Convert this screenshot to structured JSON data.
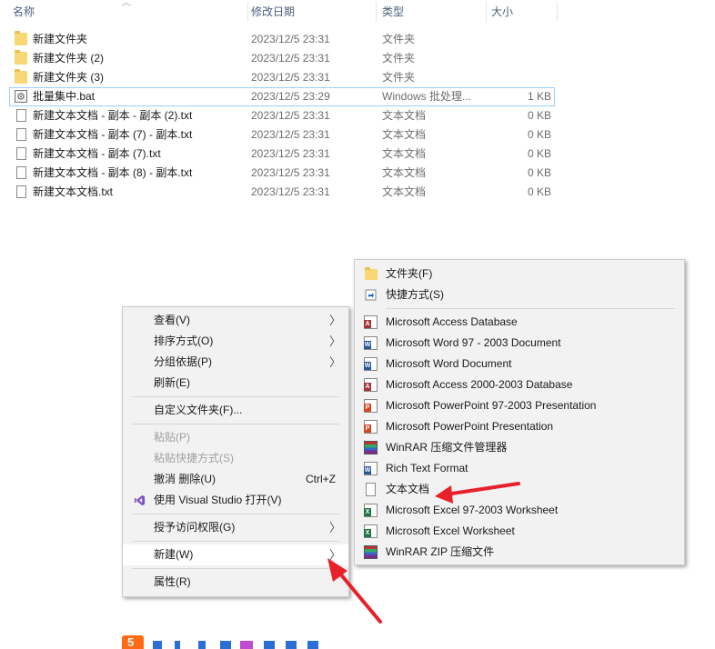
{
  "columns": {
    "name": "名称",
    "date": "修改日期",
    "type": "类型",
    "size": "大小"
  },
  "files": [
    {
      "name": "新建文件夹",
      "date": "2023/12/5 23:31",
      "type": "文件夹",
      "size": "",
      "icon": "folder-icon"
    },
    {
      "name": "新建文件夹 (2)",
      "date": "2023/12/5 23:31",
      "type": "文件夹",
      "size": "",
      "icon": "folder-icon"
    },
    {
      "name": "新建文件夹 (3)",
      "date": "2023/12/5 23:31",
      "type": "文件夹",
      "size": "",
      "icon": "folder-icon"
    },
    {
      "name": "批量集中.bat",
      "date": "2023/12/5 23:29",
      "type": "Windows 批处理...",
      "size": "1 KB",
      "icon": "batch-file-icon"
    },
    {
      "name": "新建文本文档 - 副本 - 副本 (2).txt",
      "date": "2023/12/5 23:31",
      "type": "文本文档",
      "size": "0 KB",
      "icon": "text-file-icon"
    },
    {
      "name": "新建文本文档 - 副本 (7) - 副本.txt",
      "date": "2023/12/5 23:31",
      "type": "文本文档",
      "size": "0 KB",
      "icon": "text-file-icon"
    },
    {
      "name": "新建文本文档 - 副本 (7).txt",
      "date": "2023/12/5 23:31",
      "type": "文本文档",
      "size": "0 KB",
      "icon": "text-file-icon"
    },
    {
      "name": "新建文本文档 - 副本 (8) - 副本.txt",
      "date": "2023/12/5 23:31",
      "type": "文本文档",
      "size": "0 KB",
      "icon": "text-file-icon"
    },
    {
      "name": "新建文本文档.txt",
      "date": "2023/12/5 23:31",
      "type": "文本文档",
      "size": "0 KB",
      "icon": "text-file-icon"
    }
  ],
  "context_menu": {
    "view": "查看(V)",
    "sort": "排序方式(O)",
    "group": "分组依据(P)",
    "refresh": "刷新(E)",
    "customize": "自定义文件夹(F)...",
    "paste": "粘贴(P)",
    "paste_shortcut": "粘贴快捷方式(S)",
    "undo": "撤消 删除(U)",
    "undo_shortcut": "Ctrl+Z",
    "open_vs": "使用 Visual Studio 打开(V)",
    "grant_access": "授予访问权限(G)",
    "new": "新建(W)",
    "properties": "属性(R)"
  },
  "new_submenu": {
    "folder": "文件夹(F)",
    "shortcut": "快捷方式(S)",
    "items": [
      {
        "label": "Microsoft Access Database",
        "icon": "access-icon",
        "color": "#a4373a",
        "tag": "A"
      },
      {
        "label": "Microsoft Word 97 - 2003 Document",
        "icon": "word-icon",
        "color": "#2b579a",
        "tag": "W"
      },
      {
        "label": "Microsoft Word Document",
        "icon": "word-icon",
        "color": "#2b579a",
        "tag": "W"
      },
      {
        "label": "Microsoft Access 2000-2003 Database",
        "icon": "access-icon",
        "color": "#a4373a",
        "tag": "A"
      },
      {
        "label": "Microsoft PowerPoint 97-2003 Presentation",
        "icon": "powerpoint-icon",
        "color": "#d24726",
        "tag": "P"
      },
      {
        "label": "Microsoft PowerPoint Presentation",
        "icon": "powerpoint-icon",
        "color": "#d24726",
        "tag": "P"
      },
      {
        "label": "WinRAR 压缩文件管理器",
        "icon": "winrar-icon",
        "color": "#7b2c8c",
        "tag": ""
      },
      {
        "label": "Rich Text Format",
        "icon": "wordpad-icon",
        "color": "#2b579a",
        "tag": "W"
      },
      {
        "label": "文本文档",
        "icon": "text-file-icon",
        "color": "#888888",
        "tag": ""
      },
      {
        "label": "Microsoft Excel 97-2003 Worksheet",
        "icon": "excel-icon",
        "color": "#217346",
        "tag": "X"
      },
      {
        "label": "Microsoft Excel Worksheet",
        "icon": "excel-icon",
        "color": "#217346",
        "tag": "X"
      },
      {
        "label": "WinRAR ZIP 压缩文件",
        "icon": "winrar-icon",
        "color": "#7b2c8c",
        "tag": ""
      }
    ]
  },
  "colors": {
    "annotation_arrow": "#e8202a",
    "menu_bg": "#f2f2f2",
    "selection_outline": "#99d1ff"
  }
}
